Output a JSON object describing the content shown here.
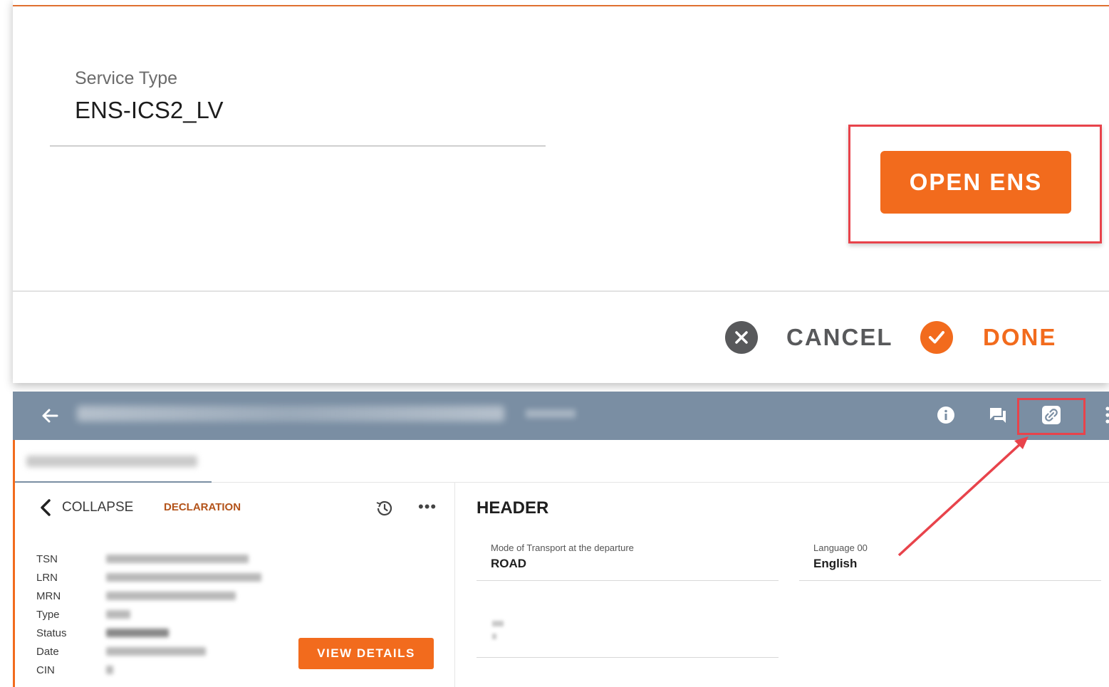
{
  "dialog": {
    "field_label": "Service Type",
    "field_value": "ENS-ICS2_LV",
    "open_button": "OPEN ENS",
    "cancel_label": "CANCEL",
    "done_label": "DONE"
  },
  "appbar": {
    "icons": [
      "back-arrow-icon",
      "info-icon",
      "chat-icon",
      "link-icon",
      "more-vertical-icon"
    ]
  },
  "left_panel": {
    "collapse_label": "COLLAPSE",
    "section_label": "DECLARATION",
    "info_labels": [
      "TSN",
      "LRN",
      "MRN",
      "Type",
      "Status",
      "Date",
      "CIN"
    ],
    "view_details": "VIEW DETAILS"
  },
  "right_panel": {
    "title": "HEADER",
    "fields": [
      {
        "label": "Mode of Transport at the departure",
        "value": "ROAD"
      },
      {
        "label": "Language 00",
        "value": "English"
      }
    ]
  },
  "colors": {
    "accent": "#f26b1d",
    "appbar": "#7a8ea3",
    "highlight": "#e8434b"
  }
}
